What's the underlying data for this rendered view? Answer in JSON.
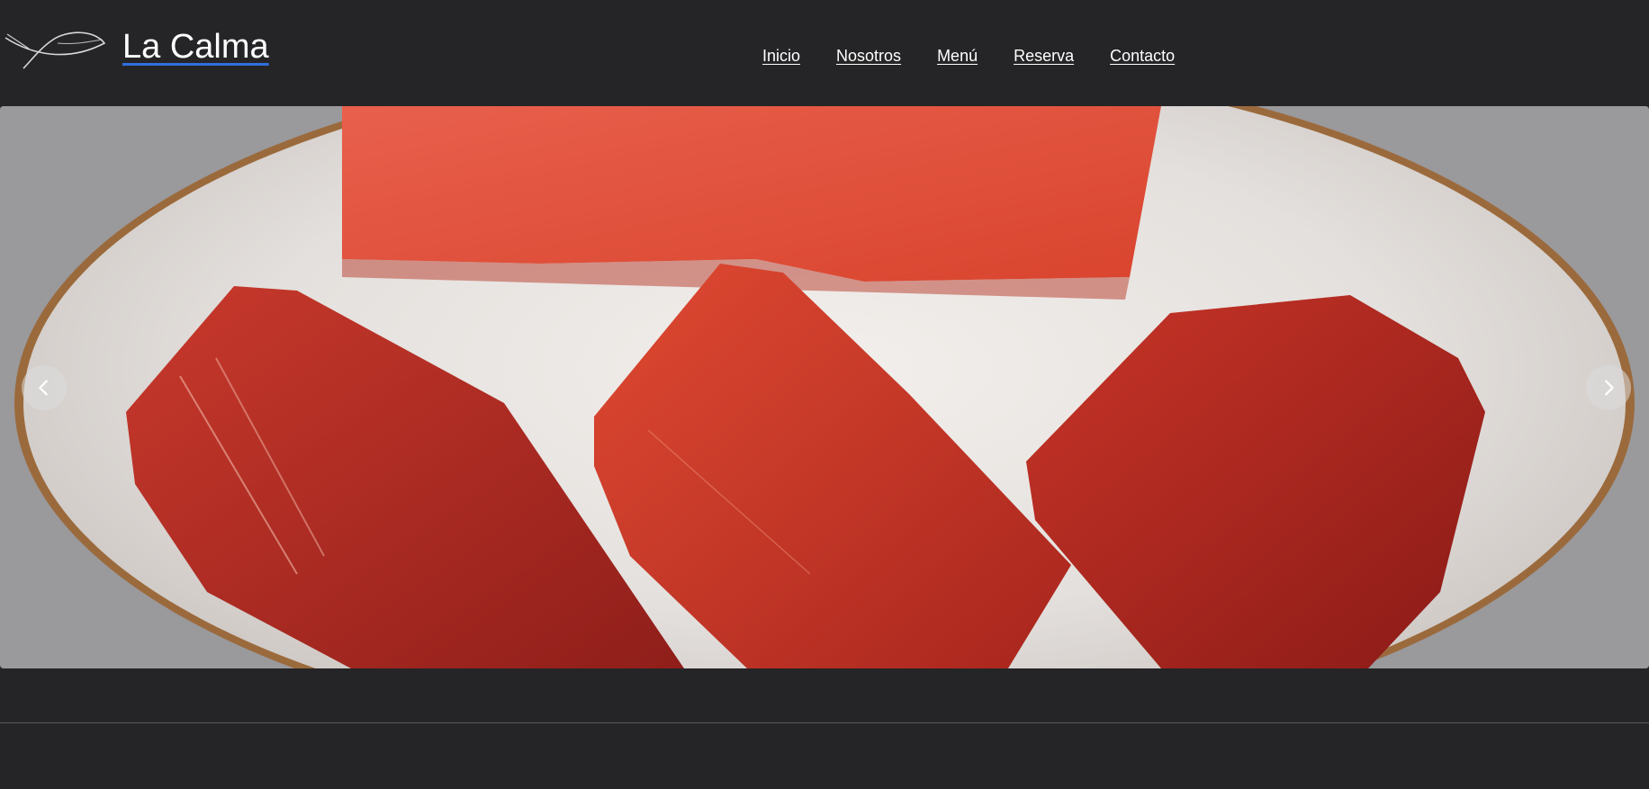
{
  "brand": {
    "name": "La Calma",
    "logo_icon": "fish-line-icon"
  },
  "nav": {
    "items": [
      {
        "label": "Inicio"
      },
      {
        "label": "Nosotros"
      },
      {
        "label": "Menú"
      },
      {
        "label": "Reserva"
      },
      {
        "label": "Contacto"
      }
    ]
  },
  "carousel": {
    "slide_image": "raw tuna fillets on marble plate",
    "prev_icon": "chevron-left-icon",
    "next_icon": "chevron-right-icon"
  },
  "colors": {
    "background": "#252527",
    "text": "#ffffff",
    "brand_underline": "#2f6fe0"
  }
}
